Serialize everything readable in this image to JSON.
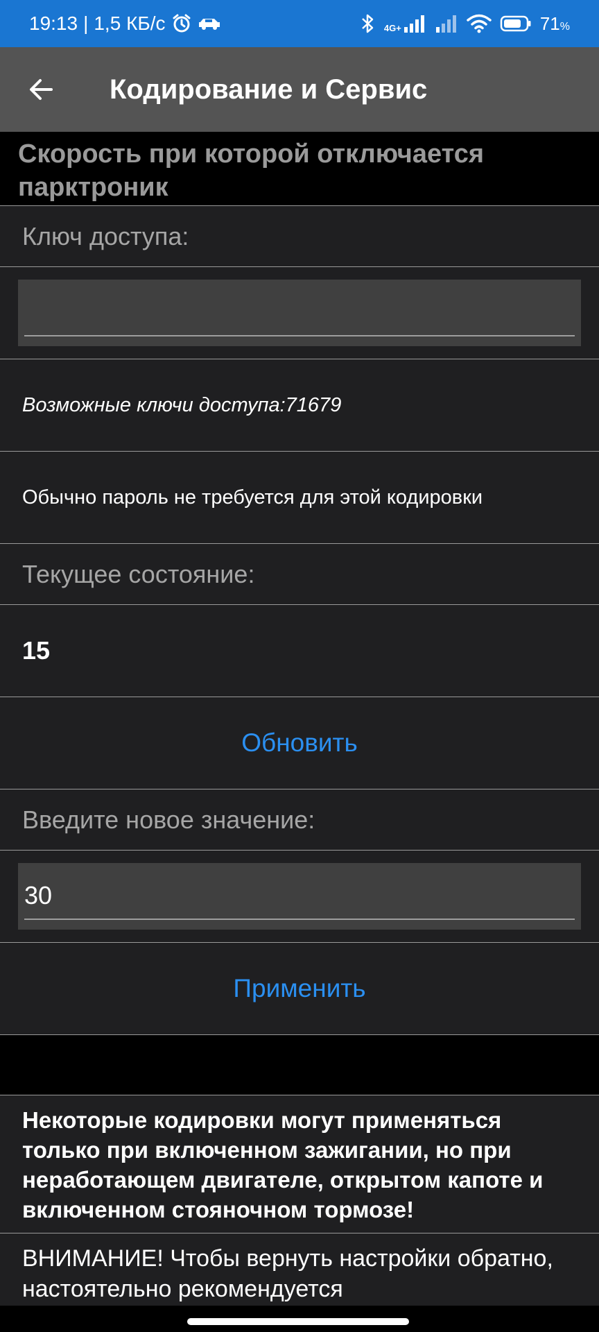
{
  "status_bar": {
    "time": "19:13",
    "separator": "|",
    "speed": "1,5 КБ/с",
    "network_type": "4G+",
    "battery": "71",
    "battery_unit": "%",
    "icons": [
      "alarm-icon",
      "car-icon",
      "bluetooth-icon",
      "signal-icon",
      "signal-weak-icon",
      "wifi-icon",
      "battery-icon"
    ]
  },
  "app_bar": {
    "title": "Кодирование и Сервис",
    "back_icon": "arrow-left-icon"
  },
  "content": {
    "heading": "Скорость при которой отключается парктроник",
    "access_key_label": "Ключ доступа:",
    "access_key_value": "",
    "possible_keys": "Возможные ключи доступа:71679",
    "password_note": "Обычно пароль не требуется для этой кодировки",
    "current_state_label": "Текущее состояние:",
    "current_state_value": "15",
    "refresh_label": "Обновить",
    "new_value_label": "Введите новое значение:",
    "new_value": "30",
    "apply_label": "Применить",
    "warning_text": "Некоторые кодировки могут применяться только при включенном зажигании, но при неработающем двигателе, открытом капоте и включенном стояночном тормозе!",
    "attention_text": "ВНИМАНИЕ! Чтобы вернуть настройки обратно, настоятельно рекомендуется"
  },
  "colors": {
    "status_bar": "#1a76d2",
    "app_bar": "#545454",
    "accent": "#2b8ff0",
    "card": "#1f1f21",
    "input": "#404040"
  }
}
